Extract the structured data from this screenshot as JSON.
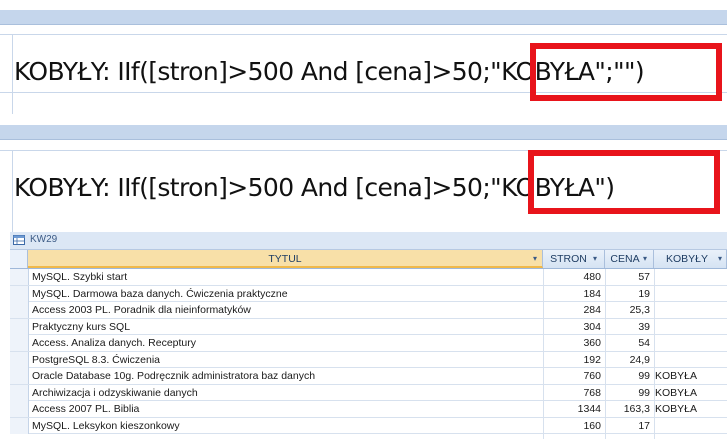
{
  "expressions": [
    {
      "text": "KOBYŁY: IIf([stron]>500 And [cena]>50;\"KOBYŁA\";\"\")"
    },
    {
      "text": "KOBYŁY: IIf([stron]>500 And [cena]>50;\"KOBYŁA\")"
    }
  ],
  "datasheet": {
    "title": "KW29",
    "columns": [
      {
        "label": "TYTUL",
        "arrow": "▾"
      },
      {
        "label": "STRON",
        "arrow": "▾"
      },
      {
        "label": "CENA",
        "arrow": "▾"
      },
      {
        "label": "KOBYŁY",
        "arrow": "▾"
      }
    ],
    "rows": [
      {
        "tytul": "MySQL. Szybki start",
        "stron": "480",
        "cena": "57",
        "kobyly": ""
      },
      {
        "tytul": "MySQL. Darmowa baza danych. Ćwiczenia praktyczne",
        "stron": "184",
        "cena": "19",
        "kobyly": ""
      },
      {
        "tytul": "Access 2003 PL. Poradnik dla nieinformatyków",
        "stron": "284",
        "cena": "25,3",
        "kobyly": ""
      },
      {
        "tytul": "Praktyczny kurs SQL",
        "stron": "304",
        "cena": "39",
        "kobyly": ""
      },
      {
        "tytul": "Access. Analiza danych. Receptury",
        "stron": "360",
        "cena": "54",
        "kobyly": ""
      },
      {
        "tytul": "PostgreSQL 8.3. Ćwiczenia",
        "stron": "192",
        "cena": "24,9",
        "kobyly": ""
      },
      {
        "tytul": "Oracle Database 10g. Podręcznik administratora baz danych",
        "stron": "760",
        "cena": "99",
        "kobyly": "KOBYŁA"
      },
      {
        "tytul": "Archiwizacja i odzyskiwanie danych",
        "stron": "768",
        "cena": "99",
        "kobyly": "KOBYŁA"
      },
      {
        "tytul": "Access 2007 PL. Biblia",
        "stron": "1344",
        "cena": "163,3",
        "kobyly": "KOBYŁA"
      },
      {
        "tytul": "MySQL. Leksykon kieszonkowy",
        "stron": "160",
        "cena": "17",
        "kobyly": ""
      }
    ]
  },
  "colors": {
    "highlight": "#e8141b",
    "header_selected": "#f8e0a8"
  }
}
